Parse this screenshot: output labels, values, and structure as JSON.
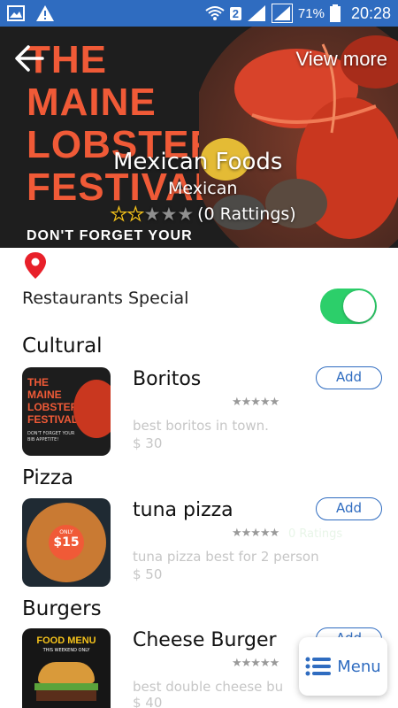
{
  "status_bar": {
    "battery": "71%",
    "time": "20:28",
    "sim": "2"
  },
  "hero": {
    "poster_lines": [
      "THE",
      "MAINE",
      "LOBSTER",
      "FESTIVAL"
    ],
    "poster_subline": "DON'T FORGET YOUR",
    "view_more": "View more",
    "name": "Mexican Foods",
    "cuisine": "Mexican",
    "rating_text": "(0 Rattings)",
    "rating_value": 2,
    "rating_max": 5
  },
  "special": {
    "label": "Restaurants Special",
    "enabled": true,
    "accent": "#2ccf6a"
  },
  "categories": [
    {
      "title": "Cultural",
      "item": {
        "name": "Boritos",
        "add_label": "Add",
        "desc": "best boritos in town.",
        "price": "$ 30",
        "thumb_lines": [
          "THE",
          "MAINE",
          "LOBSTER",
          "FESTIVAL"
        ],
        "thumb_sub": "DON'T FORGET YOUR BIB APPETITE!"
      }
    },
    {
      "title": "Pizza",
      "item": {
        "name": "tuna pizza",
        "add_label": "Add",
        "ratings": "0 Ratings",
        "desc": "tuna pizza best for 2 person",
        "price": "$ 50",
        "thumb_badge_top": "ONLY",
        "thumb_badge_price": "$15"
      }
    },
    {
      "title": "Burgers",
      "item": {
        "name": "Cheese Burger",
        "add_label": "Add",
        "desc": "best double cheese bu",
        "price": "$ 40",
        "thumb_title": "FOOD MENU",
        "thumb_sub": "THIS WEEKEND ONLY"
      }
    }
  ],
  "menu_fab": {
    "label": "Menu"
  },
  "colors": {
    "brand": "#2f6cc0",
    "poster_red": "#f05a37"
  }
}
